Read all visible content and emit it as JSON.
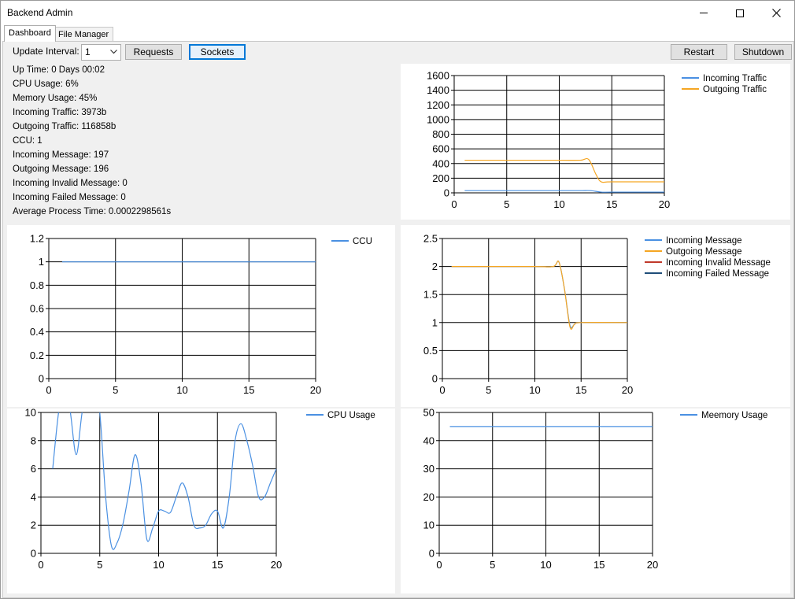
{
  "window": {
    "title": "Backend Admin"
  },
  "tabs": [
    {
      "label": "Dashboard"
    },
    {
      "label": "File Manager"
    }
  ],
  "toolbar": {
    "update_interval_label": "Update Interval:",
    "update_interval_value": "1",
    "requests_label": "Requests",
    "sockets_label": "Sockets",
    "restart_label": "Restart",
    "shutdown_label": "Shutdown"
  },
  "stats": [
    "Up Time: 0 Days 00:02",
    "CPU Usage: 6%",
    "Memory Usage: 45%",
    "Incoming Traffic: 3973b",
    "Outgoing Traffic: 116858b",
    "CCU: 1",
    "Incoming Message: 197",
    "Outgoing Message: 196",
    "Incoming Invalid Message: 0",
    "Incoming Failed Message: 0",
    "Average Process Time: 0.0002298561s"
  ],
  "chart_data": [
    {
      "id": "traffic",
      "type": "line",
      "xlim": [
        0,
        20
      ],
      "xticks": [
        0,
        5,
        10,
        15,
        20
      ],
      "ylim": [
        0,
        1600
      ],
      "yticks": [
        0,
        200,
        400,
        600,
        800,
        1000,
        1200,
        1400,
        1600
      ],
      "legend_position": "top-right",
      "series": [
        {
          "name": "Incoming Traffic",
          "color": "#4a90e2",
          "x": [
            1,
            5,
            10,
            12,
            13,
            14,
            15,
            20
          ],
          "y": [
            30,
            30,
            30,
            30,
            30,
            10,
            10,
            10
          ]
        },
        {
          "name": "Outgoing Traffic",
          "color": "#f5a623",
          "x": [
            1,
            5,
            10,
            12,
            12.8,
            13.5,
            14,
            15,
            20
          ],
          "y": [
            445,
            445,
            445,
            445,
            455,
            250,
            150,
            150,
            150
          ]
        }
      ]
    },
    {
      "id": "ccu",
      "type": "line",
      "xlim": [
        0,
        20
      ],
      "xticks": [
        0,
        5,
        10,
        15,
        20
      ],
      "ylim": [
        0,
        1.2
      ],
      "yticks": [
        0,
        0.2,
        0.4,
        0.6,
        0.8,
        1,
        1.2
      ],
      "legend_position": "top-right",
      "series": [
        {
          "name": "CCU",
          "color": "#4a90e2",
          "x": [
            1,
            5,
            10,
            15,
            20
          ],
          "y": [
            1,
            1,
            1,
            1,
            1
          ]
        }
      ]
    },
    {
      "id": "messages",
      "type": "line",
      "xlim": [
        0,
        20
      ],
      "xticks": [
        0,
        5,
        10,
        15,
        20
      ],
      "ylim": [
        0,
        2.5
      ],
      "yticks": [
        0,
        0.5,
        1,
        1.5,
        2,
        2.5
      ],
      "legend_position": "top-right",
      "series": [
        {
          "name": "Incoming Message",
          "color": "#4a90e2",
          "x": [
            1,
            5,
            10,
            12,
            12.6,
            13.2,
            13.8,
            14.3,
            15,
            20
          ],
          "y": [
            2,
            2,
            2,
            2,
            2.08,
            1.6,
            0.95,
            0.97,
            1,
            1
          ]
        },
        {
          "name": "Outgoing Message",
          "color": "#f5a623",
          "x": [
            1,
            5,
            10,
            12,
            12.6,
            13.2,
            13.8,
            14.3,
            15,
            20
          ],
          "y": [
            2,
            2,
            2,
            2,
            2.08,
            1.6,
            0.92,
            0.97,
            1,
            1
          ]
        },
        {
          "name": "Incoming Invalid Message",
          "color": "#c0392b",
          "x": [],
          "y": []
        },
        {
          "name": "Incoming Failed Message",
          "color": "#1f4e79",
          "x": [],
          "y": []
        }
      ]
    },
    {
      "id": "cpu",
      "type": "line",
      "xlim": [
        0,
        20
      ],
      "xticks": [
        0,
        5,
        10,
        15,
        20
      ],
      "ylim": [
        0,
        10
      ],
      "yticks": [
        0,
        2,
        4,
        6,
        8,
        10
      ],
      "legend_position": "top-right",
      "series": [
        {
          "name": "CPU Usage",
          "color": "#4a90e2",
          "x": [
            1,
            1.5,
            2,
            2.5,
            3,
            3.5,
            4,
            4.5,
            5,
            5.5,
            6,
            6.5,
            7,
            7.5,
            8,
            8.5,
            9,
            9.5,
            10,
            10.5,
            11,
            11.5,
            12,
            12.5,
            13,
            13.5,
            14,
            14.5,
            15,
            15.5,
            16,
            16.5,
            17,
            17.5,
            18,
            18.5,
            19,
            19.5,
            20
          ],
          "y": [
            6,
            10,
            12,
            10,
            7,
            10,
            12,
            12,
            10,
            4,
            0.5,
            0.8,
            2.2,
            4.5,
            7,
            5,
            1,
            1.8,
            3,
            3,
            2.9,
            4,
            5,
            4,
            2,
            1.8,
            2,
            2.8,
            3,
            1.8,
            4,
            8,
            9.2,
            8,
            6.2,
            4,
            4,
            5,
            6
          ]
        }
      ]
    },
    {
      "id": "memory",
      "type": "line",
      "xlim": [
        0,
        20
      ],
      "xticks": [
        0,
        5,
        10,
        15,
        20
      ],
      "ylim": [
        0,
        50
      ],
      "yticks": [
        0,
        10,
        20,
        30,
        40,
        50
      ],
      "legend_position": "top-right",
      "series": [
        {
          "name": "Meemory Usage",
          "color": "#4a90e2",
          "x": [
            1,
            5,
            10,
            15,
            20
          ],
          "y": [
            45,
            45,
            45,
            45,
            45
          ]
        }
      ]
    }
  ]
}
